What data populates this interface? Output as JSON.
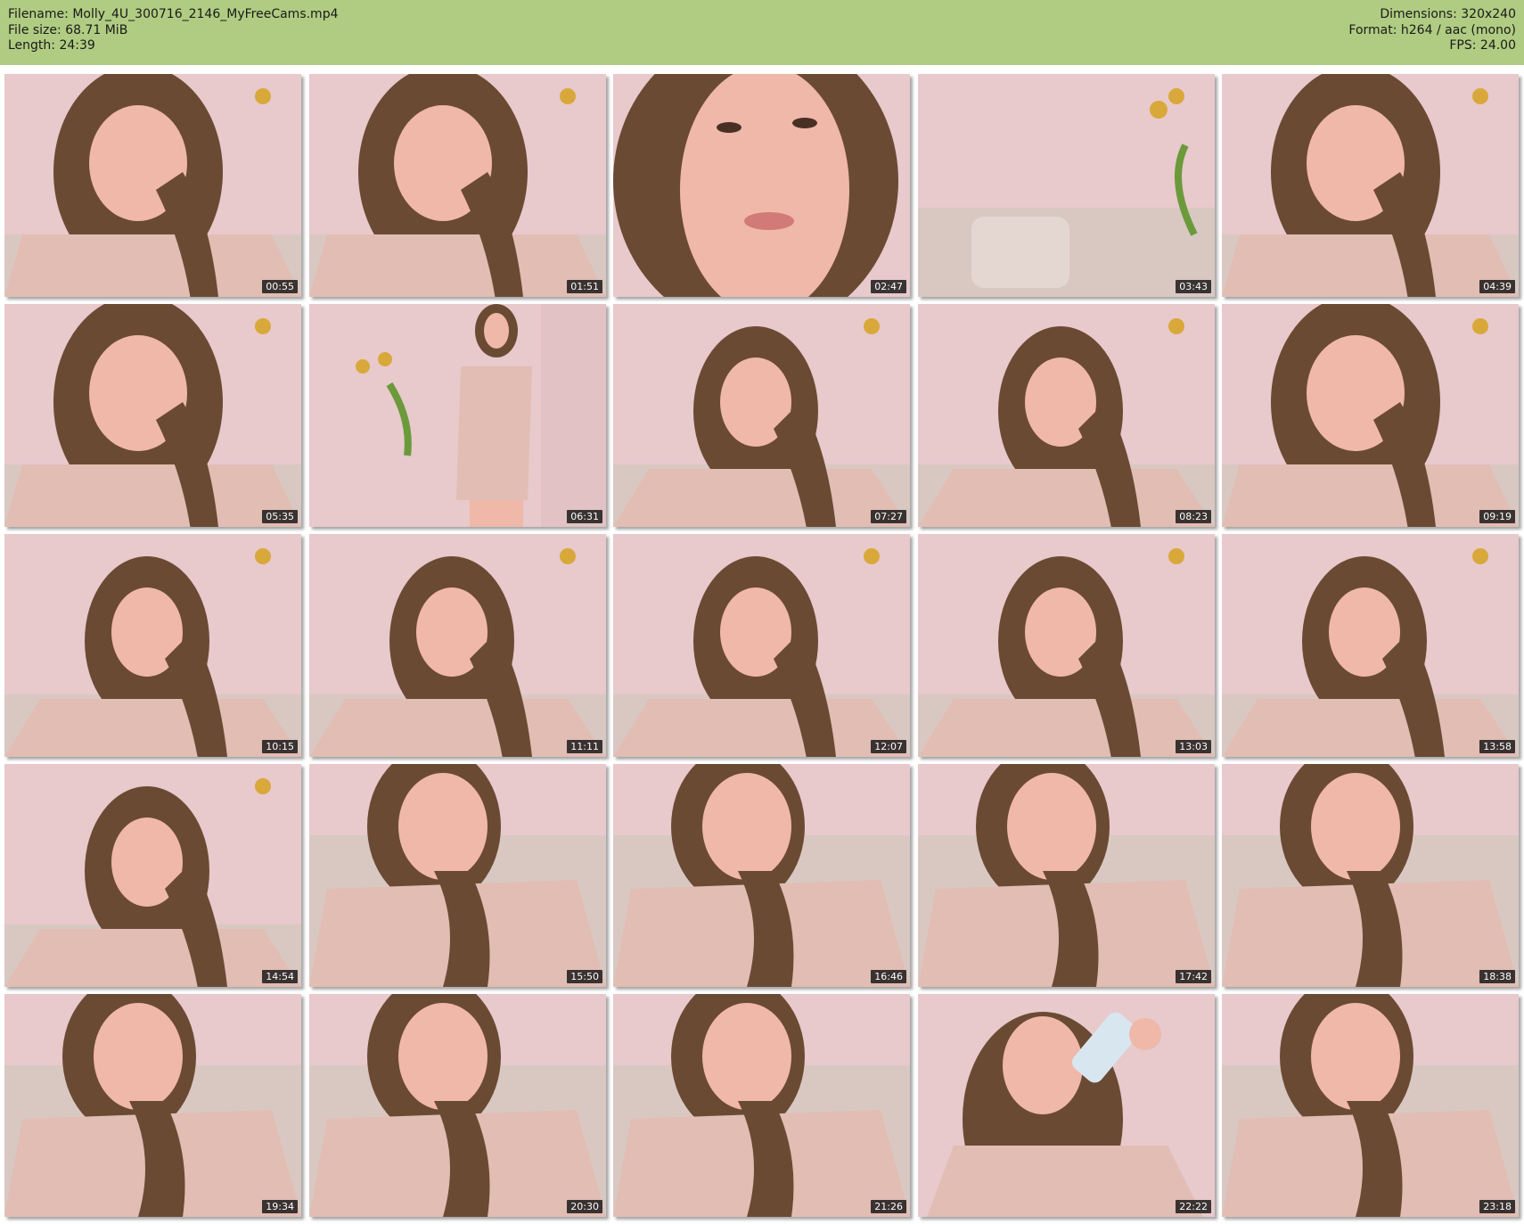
{
  "header": {
    "filename_label": "Filename:",
    "filename": "Molly_4U_300716_2146_MyFreeCams.mp4",
    "filesize_label": "File size:",
    "filesize": "68.71 MiB",
    "length_label": "Length:",
    "length": "24:39",
    "dimensions_label": "Dimensions:",
    "dimensions": "320x240",
    "format_label": "Format:",
    "format": "h264 / aac (mono)",
    "fps_label": "FPS:",
    "fps": "24.00"
  },
  "colors": {
    "header_bg": "#b0cc82",
    "wall": "#e8c9cc",
    "shirt": "#e2bdb3",
    "hair": "#6b4a34",
    "skin": "#efb8a8",
    "couch": "#d9c8c2"
  },
  "thumbnails": [
    {
      "time": "00:55",
      "scene": "closeup"
    },
    {
      "time": "01:51",
      "scene": "closeup"
    },
    {
      "time": "02:47",
      "scene": "face"
    },
    {
      "time": "03:43",
      "scene": "empty"
    },
    {
      "time": "04:39",
      "scene": "closeup"
    },
    {
      "time": "05:35",
      "scene": "closeup"
    },
    {
      "time": "06:31",
      "scene": "standing"
    },
    {
      "time": "07:27",
      "scene": "seated"
    },
    {
      "time": "08:23",
      "scene": "seated"
    },
    {
      "time": "09:19",
      "scene": "closeup"
    },
    {
      "time": "10:15",
      "scene": "seated"
    },
    {
      "time": "11:11",
      "scene": "seated"
    },
    {
      "time": "12:07",
      "scene": "seated"
    },
    {
      "time": "13:03",
      "scene": "seated"
    },
    {
      "time": "13:58",
      "scene": "seated"
    },
    {
      "time": "14:54",
      "scene": "seated"
    },
    {
      "time": "15:50",
      "scene": "reclined"
    },
    {
      "time": "16:46",
      "scene": "reclined"
    },
    {
      "time": "17:42",
      "scene": "reclined"
    },
    {
      "time": "18:38",
      "scene": "reclined"
    },
    {
      "time": "19:34",
      "scene": "reclined"
    },
    {
      "time": "20:30",
      "scene": "reclined"
    },
    {
      "time": "21:26",
      "scene": "reclined"
    },
    {
      "time": "22:22",
      "scene": "drinking"
    },
    {
      "time": "23:18",
      "scene": "reclined"
    }
  ]
}
